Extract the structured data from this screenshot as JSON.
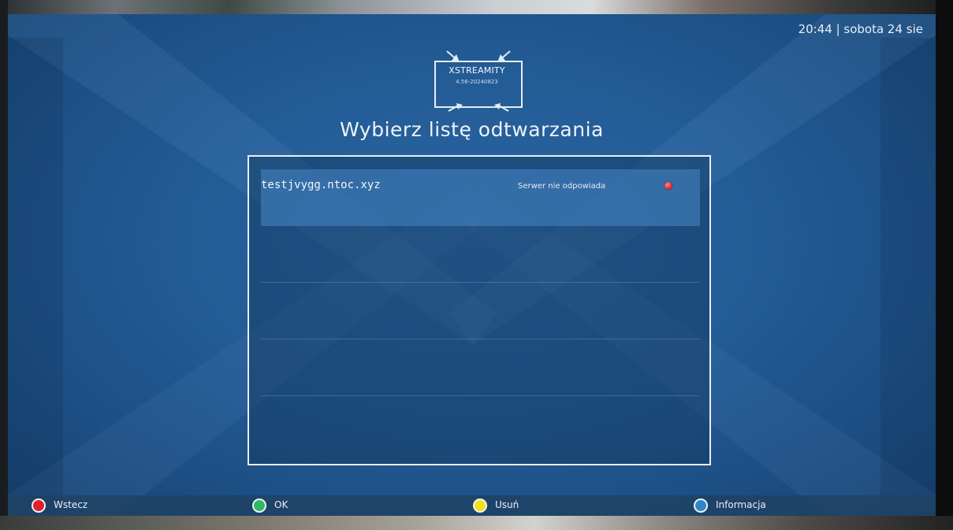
{
  "clock": "20:44 | sobota 24 sie",
  "logo": {
    "title": "XSTREAMITY",
    "version": "4.56-20240823"
  },
  "heading": "Wybierz listę odtwarzania",
  "playlists": [
    {
      "name": "testjvygg.ntoc.xyz",
      "status": "Serwer nie odpowiada",
      "status_color": "#e0303a",
      "selected": true
    }
  ],
  "buttons": [
    {
      "label": "Wstecz",
      "color": "#e0202a",
      "icon": "red-button-icon"
    },
    {
      "label": "OK",
      "color": "#2fb86a",
      "icon": "green-button-icon"
    },
    {
      "label": "Usuń",
      "color": "#f2e21a",
      "icon": "yellow-button-icon"
    },
    {
      "label": "Informacja",
      "color": "#2f86c8",
      "icon": "blue-button-icon"
    }
  ],
  "colors": {
    "panel": "#235b95",
    "accent": "#e8eef5"
  }
}
